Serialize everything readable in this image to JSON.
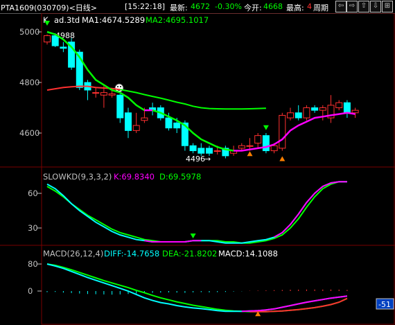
{
  "header": {
    "symbol": "PTA1609(030709)<日线>",
    "time": "[15:22:18]",
    "latest_label": "最新:",
    "latest_value": "4672",
    "change": "-0.30%",
    "open_label": "今开:",
    "open_value": "4668",
    "high_label": "最高:",
    "high_value": "4",
    "period_label": "周期",
    "nav_buttons": [
      "⇦",
      "⇨",
      "⇧",
      "⇩",
      "⊞"
    ]
  },
  "colors": {
    "up": "#ff3030",
    "down": "#00ffff",
    "ma1": "#ffffff",
    "ma2": "#00ff00",
    "kd_k": "#ff00ff",
    "kd_d": "#00ff00",
    "macd_diff": "#00ffff",
    "macd_dea": "#00ff00"
  },
  "main_panel": {
    "legend_k": "K",
    "legend_name": "ad.3td",
    "ma1": "MA1:4674.5289",
    "ma2": "MA2:4695.1017",
    "y_ticks": [
      "5000",
      "4800",
      "4600"
    ],
    "high_mark": "4988",
    "low_mark": "4496"
  },
  "kd_panel": {
    "title": "SLOWKD(9,3,3,2)",
    "k": "K:69.8340",
    "d": "D:69.5978",
    "y_ticks": [
      "60",
      "30"
    ]
  },
  "macd_panel": {
    "title": "MACD(26,12,4)",
    "diff": "DIFF:-14.7658",
    "dea": "DEA:-21.8202",
    "macd": "MACD:14.1088",
    "y_ticks": [
      "80",
      "0"
    ],
    "value_badge": "-51"
  },
  "chart_data": {
    "type": "candlestick",
    "candles": [
      {
        "o": 4960,
        "c": 4985,
        "h": 4990,
        "l": 4950
      },
      {
        "o": 4985,
        "c": 4945,
        "h": 4995,
        "l": 4940
      },
      {
        "o": 4940,
        "c": 4935,
        "h": 4960,
        "l": 4920
      },
      {
        "o": 4960,
        "c": 4860,
        "h": 4975,
        "l": 4850
      },
      {
        "o": 4920,
        "c": 4780,
        "h": 4930,
        "l": 4770
      },
      {
        "o": 4800,
        "c": 4770,
        "h": 4810,
        "l": 4730
      },
      {
        "o": 4760,
        "c": 4760,
        "h": 4780,
        "l": 4740
      },
      {
        "o": 4750,
        "c": 4760,
        "h": 4790,
        "l": 4700
      },
      {
        "o": 4750,
        "c": 4755,
        "h": 4770,
        "l": 4740
      },
      {
        "o": 4750,
        "c": 4660,
        "h": 4755,
        "l": 4640
      },
      {
        "o": 4680,
        "c": 4610,
        "h": 4700,
        "l": 4580
      },
      {
        "o": 4610,
        "c": 4630,
        "h": 4680,
        "l": 4600
      },
      {
        "o": 4650,
        "c": 4660,
        "h": 4700,
        "l": 4640
      },
      {
        "o": 4700,
        "c": 4690,
        "h": 4720,
        "l": 4670
      },
      {
        "o": 4700,
        "c": 4660,
        "h": 4710,
        "l": 4650
      },
      {
        "o": 4660,
        "c": 4620,
        "h": 4680,
        "l": 4610
      },
      {
        "o": 4640,
        "c": 4620,
        "h": 4660,
        "l": 4600
      },
      {
        "o": 4640,
        "c": 4550,
        "h": 4650,
        "l": 4530
      },
      {
        "o": 4550,
        "c": 4530,
        "h": 4560,
        "l": 4520
      },
      {
        "o": 4540,
        "c": 4520,
        "h": 4560,
        "l": 4510
      },
      {
        "o": 4540,
        "c": 4520,
        "h": 4550,
        "l": 4510
      },
      {
        "o": 4530,
        "c": 4530,
        "h": 4550,
        "l": 4515
      },
      {
        "o": 4540,
        "c": 4510,
        "h": 4550,
        "l": 4500
      },
      {
        "o": 4520,
        "c": 4530,
        "h": 4550,
        "l": 4510
      },
      {
        "o": 4540,
        "c": 4550,
        "h": 4560,
        "l": 4530
      },
      {
        "o": 4550,
        "c": 4550,
        "h": 4580,
        "l": 4530
      },
      {
        "o": 4560,
        "c": 4590,
        "h": 4600,
        "l": 4540
      },
      {
        "o": 4590,
        "c": 4530,
        "h": 4600,
        "l": 4520
      },
      {
        "o": 4530,
        "c": 4550,
        "h": 4560,
        "l": 4520
      },
      {
        "o": 4540,
        "c": 4670,
        "h": 4680,
        "l": 4530
      },
      {
        "o": 4660,
        "c": 4680,
        "h": 4700,
        "l": 4650
      },
      {
        "o": 4680,
        "c": 4660,
        "h": 4710,
        "l": 4650
      },
      {
        "o": 4660,
        "c": 4700,
        "h": 4710,
        "l": 4650
      },
      {
        "o": 4700,
        "c": 4690,
        "h": 4710,
        "l": 4680
      },
      {
        "o": 4690,
        "c": 4700,
        "h": 4710,
        "l": 4650
      },
      {
        "o": 4660,
        "c": 4710,
        "h": 4750,
        "l": 4640
      },
      {
        "o": 4700,
        "c": 4720,
        "h": 4730,
        "l": 4690
      },
      {
        "o": 4720,
        "c": 4680,
        "h": 4730,
        "l": 4660
      },
      {
        "o": 4680,
        "c": 4690,
        "h": 4700,
        "l": 4660
      }
    ],
    "ma1_points": [
      5000,
      4990,
      4970,
      4940,
      4900,
      4850,
      4810,
      4790,
      4770,
      4760,
      4740,
      4710,
      4690,
      4690,
      4680,
      4665,
      4650,
      4630,
      4600,
      4575,
      4560,
      4545,
      4535,
      4530,
      4530,
      4535,
      4540,
      4545,
      4555,
      4575,
      4610,
      4630,
      4645,
      4660,
      4665,
      4670,
      4675,
      4680,
      4675
    ],
    "ma2_points": [
      4770,
      4775,
      4780,
      4783,
      4785,
      4785,
      4780,
      4778,
      4776,
      4772,
      4766,
      4760,
      4752,
      4745,
      4738,
      4730,
      4722,
      4715,
      4706,
      4700,
      4697,
      4696,
      4695,
      4695,
      4695,
      4696,
      4697,
      4698
    ],
    "kd_k": [
      68,
      64,
      58,
      51,
      45,
      40,
      35,
      31,
      27,
      24,
      22,
      20,
      19,
      18,
      18,
      18,
      18,
      18,
      19,
      19,
      19,
      18,
      17,
      17,
      17,
      18,
      19,
      20,
      22,
      26,
      33,
      42,
      52,
      60,
      66,
      69,
      70,
      70
    ],
    "kd_d": [
      66,
      62,
      57,
      51,
      46,
      41,
      37,
      33,
      29,
      26,
      24,
      22,
      20,
      19,
      18,
      18,
      18,
      18,
      19,
      19,
      19,
      19,
      18,
      18,
      17,
      17,
      18,
      19,
      21,
      24,
      30,
      38,
      48,
      57,
      64,
      68,
      70,
      70
    ],
    "macd_diff": [
      80,
      74,
      67,
      58,
      49,
      40,
      32,
      24,
      16,
      8,
      0,
      -10,
      -20,
      -28,
      -34,
      -38,
      -43,
      -47,
      -50,
      -52,
      -55,
      -58,
      -60,
      -60,
      -60,
      -59,
      -58,
      -56,
      -53,
      -48,
      -43,
      -38,
      -33,
      -29,
      -25,
      -21,
      -18,
      -15
    ],
    "macd_dea": [
      80,
      76,
      70,
      63,
      55,
      47,
      39,
      31,
      24,
      17,
      10,
      2,
      -5,
      -13,
      -20,
      -26,
      -32,
      -37,
      -42,
      -46,
      -50,
      -54,
      -57,
      -59,
      -60,
      -61,
      -61,
      -61,
      -60,
      -59,
      -57,
      -55,
      -52,
      -49,
      -45,
      -40,
      -33,
      -22
    ],
    "macd_bars": [
      -10,
      -8,
      -14,
      -18,
      -22,
      -26,
      -28,
      -30,
      -32,
      -30,
      -26,
      -22,
      -18,
      -16,
      -14,
      -12,
      -14,
      -16,
      -12,
      -10,
      -12,
      -10,
      -8,
      -4,
      -2,
      2,
      4,
      6,
      8,
      10,
      12,
      13,
      14,
      14,
      14,
      14,
      13,
      10
    ]
  }
}
